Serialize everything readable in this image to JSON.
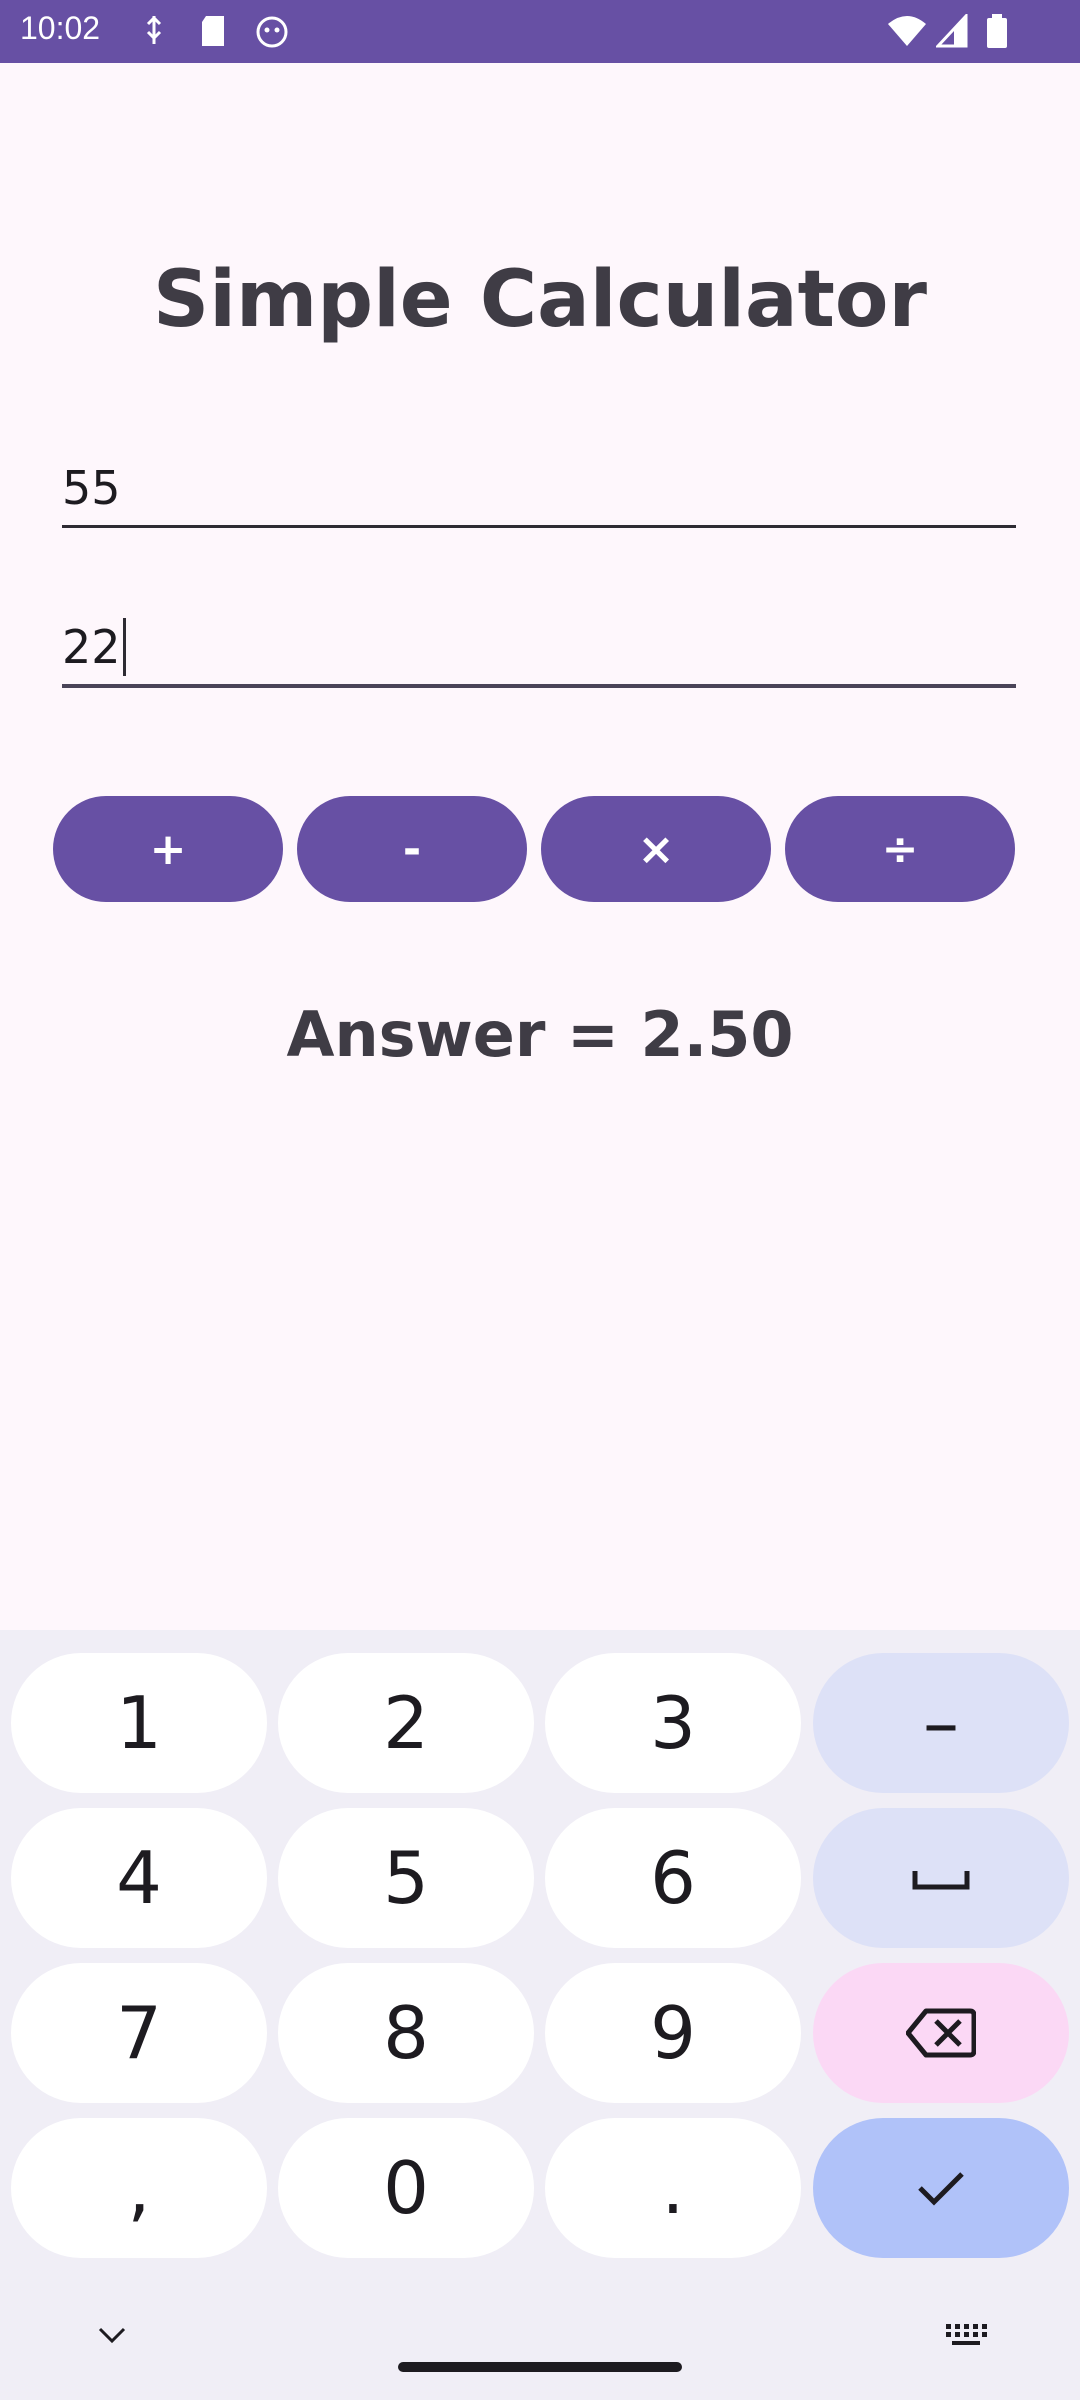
{
  "status_bar": {
    "time": "10:02",
    "left_icons": [
      "usb-debug-icon",
      "sd-card-icon",
      "android-robot-icon"
    ],
    "right_icons": [
      "wifi-icon",
      "signal-icon",
      "battery-icon"
    ]
  },
  "app": {
    "title": "Simple Calculator",
    "first_number": "55",
    "second_number": "22",
    "operations": [
      "+",
      "-",
      "×",
      "÷"
    ],
    "answer": "Answer = 2.50"
  },
  "keyboard": {
    "rows": [
      [
        "1",
        "2",
        "3",
        "–"
      ],
      [
        "4",
        "5",
        "6",
        "␣"
      ],
      [
        "7",
        "8",
        "9",
        "backspace"
      ],
      [
        ",",
        "0",
        ".",
        "enter"
      ]
    ],
    "labels": {
      "k1": "1",
      "k2": "2",
      "k3": "3",
      "dash": "–",
      "k4": "4",
      "k5": "5",
      "k6": "6",
      "k7": "7",
      "k8": "8",
      "k9": "9",
      "comma": ",",
      "k0": "0",
      "period": "."
    },
    "bottom_icons": [
      "chevron-down-icon",
      "keyboard-icon"
    ]
  },
  "colors": {
    "primary": "#6750a4",
    "background": "#fef7fc",
    "keyboard_bg": "#f0eef6",
    "key_func": "#dde1f7",
    "key_delete": "#fbd8f5",
    "key_enter": "#b0c2f9"
  }
}
